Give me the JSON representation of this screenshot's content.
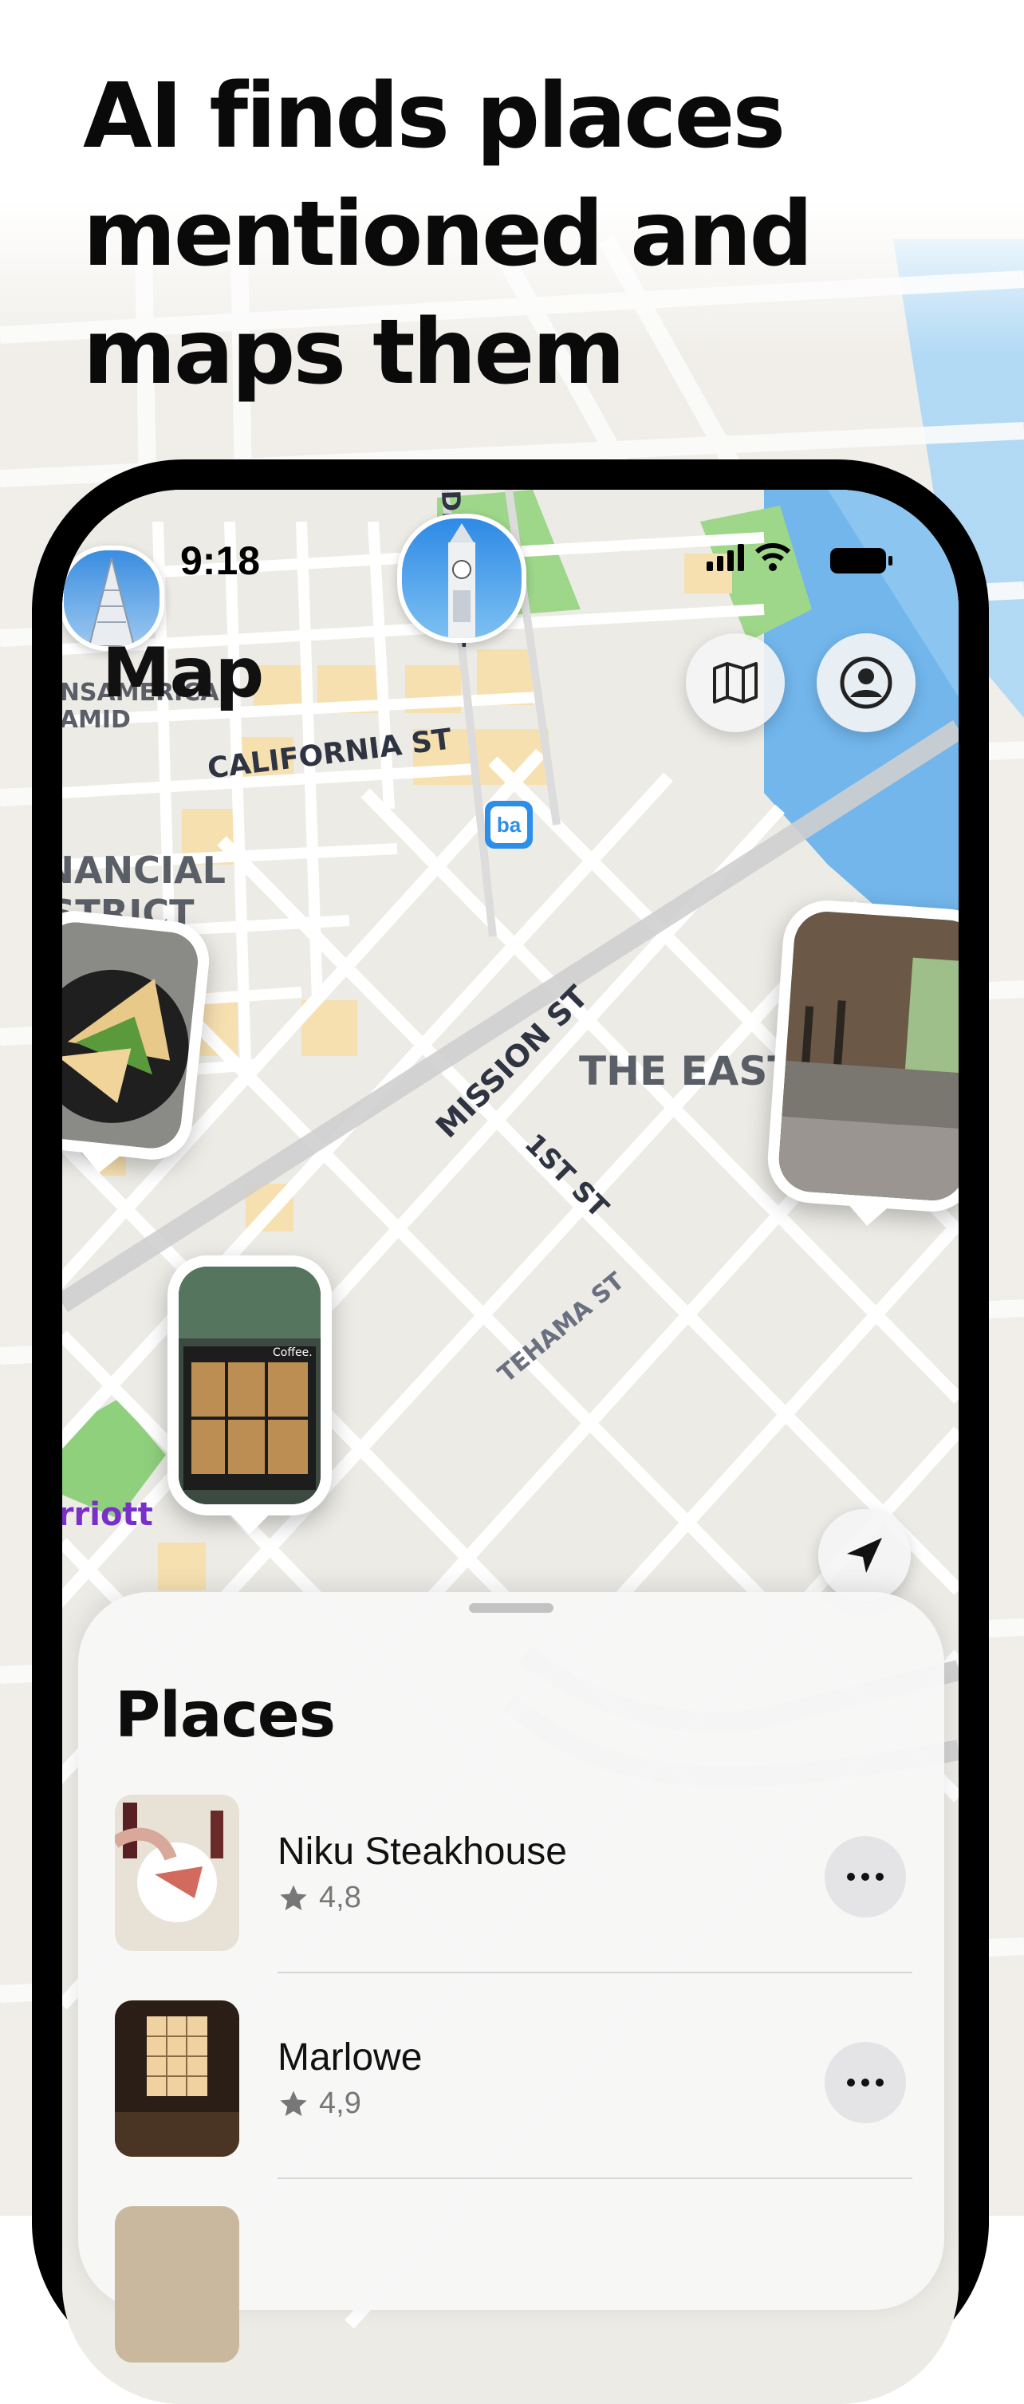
{
  "headline": {
    "line1": "AI finds places",
    "line2": "mentioned and",
    "line3": "maps them"
  },
  "status_bar": {
    "time": "9:18"
  },
  "screen": {
    "title": "Map"
  },
  "map": {
    "streets": [
      "DRUMM ST",
      "CALIFORNIA ST",
      "MISSION ST",
      "1ST ST",
      "TEHAMA ST"
    ],
    "districts": [
      "THE EAST C",
      "FINANCIAL DISTRICT",
      "TRANSAMERICA PYRAMID"
    ],
    "poi": [
      "Marriott"
    ],
    "transit_badge": "ba"
  },
  "toolbar": {
    "map_icon": "map-icon",
    "profile_icon": "person-circle-icon",
    "locate_icon": "location-arrow-icon"
  },
  "places_sheet": {
    "title": "Places",
    "items": [
      {
        "name": "Niku Steakhouse",
        "rating": "4,8"
      },
      {
        "name": "Marlowe",
        "rating": "4,9"
      }
    ]
  },
  "colors": {
    "accent_text": "#0a0a0a",
    "map_road": "#ffffff",
    "map_block": "#ecebe6",
    "map_yellow": "#f6e0b0",
    "map_park": "#9ed68a",
    "map_water": "#72b6ec",
    "poi_purple": "#7a2fc8"
  }
}
